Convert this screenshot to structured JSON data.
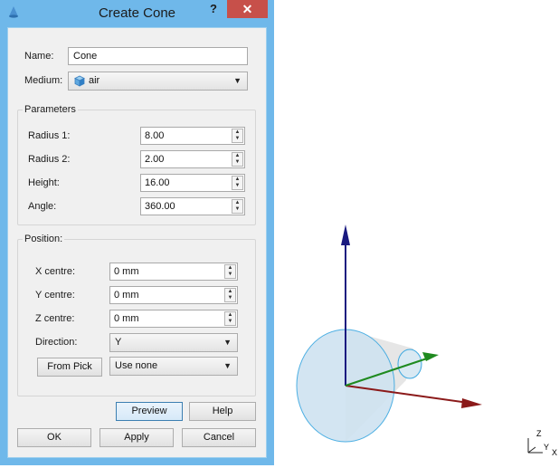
{
  "window": {
    "title": "Create Cone",
    "help": "?",
    "close": "✕"
  },
  "fields": {
    "name_label": "Name:",
    "name_value": "Cone",
    "medium_label": "Medium:",
    "medium_value": "air"
  },
  "parameters": {
    "title": "Parameters",
    "radius1_label": "Radius 1:",
    "radius1_value": "8.00",
    "radius2_label": "Radius 2:",
    "radius2_value": "2.00",
    "height_label": "Height:",
    "height_value": "16.00",
    "angle_label": "Angle:",
    "angle_value": "360.00"
  },
  "position": {
    "title": "Position:",
    "x_label": "X centre:",
    "x_value": "0 mm",
    "y_label": "Y centre:",
    "y_value": "0 mm",
    "z_label": "Z centre:",
    "z_value": "0 mm",
    "direction_label": "Direction:",
    "direction_value": "Y",
    "from_pick": "From Pick",
    "pick_value": "Use none"
  },
  "buttons": {
    "preview": "Preview",
    "help": "Help",
    "ok": "OK",
    "apply": "Apply",
    "cancel": "Cancel"
  },
  "triad": {
    "z": "Z",
    "y": "Y",
    "x": "X"
  },
  "colors": {
    "window_frame": "#6fb8ea",
    "close": "#c7504a",
    "axis_x": "#8b1a1a",
    "axis_y": "#1f8a1f",
    "axis_z": "#1a1a80",
    "cone_edge": "#3aa7e0"
  }
}
